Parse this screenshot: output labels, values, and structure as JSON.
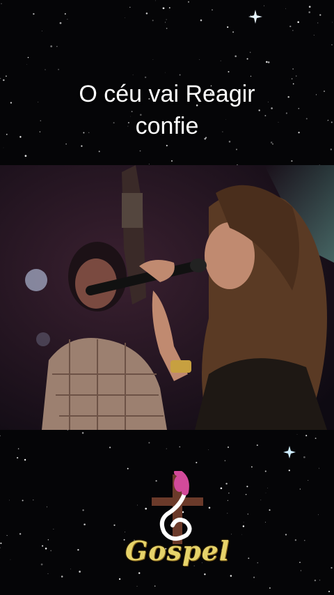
{
  "caption": {
    "line1": "O céu vai Reagir",
    "line2": "confie"
  },
  "logo": {
    "word": "Gospel",
    "icon": "treble-clef-cross-icon"
  },
  "colors": {
    "background": "#050507",
    "caption_text": "#ffffff",
    "logo_gold": "#e6d36a",
    "logo_pink": "#d24a9a",
    "cross_brown": "#6b3a2a"
  }
}
